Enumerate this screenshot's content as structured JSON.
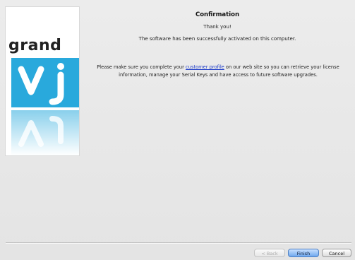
{
  "logo": {
    "word": "grand",
    "mark": "vj"
  },
  "content": {
    "title": "Confirmation",
    "thanks": "Thank you!",
    "activated": "The software has been successfully activated on this computer.",
    "info_before": "Please make sure you complete your ",
    "info_link": "customer profile",
    "info_after": " on our web site so you can retrieve your license information, manage your Serial Keys and have access to future software upgrades."
  },
  "buttons": {
    "back": "< Back",
    "finish": "Finish",
    "cancel": "Cancel"
  },
  "colors": {
    "logo_blue": "#29a9dc",
    "link": "#1a39c8",
    "default_button": "#6fa8ee"
  }
}
